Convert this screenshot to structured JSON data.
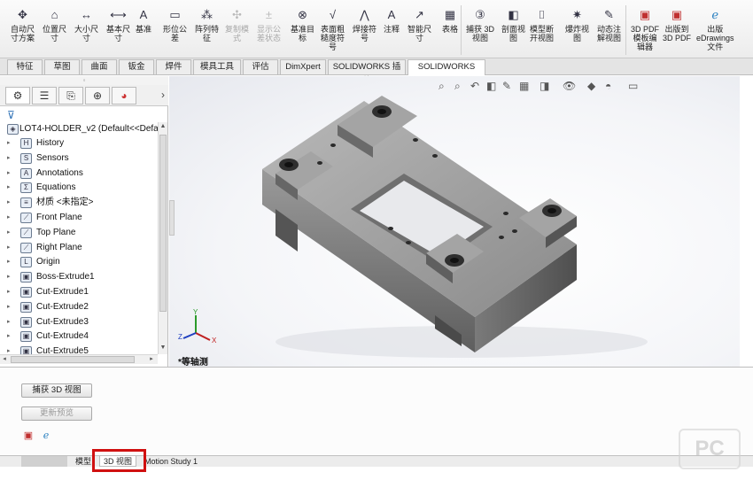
{
  "ribbon": {
    "buttons": [
      {
        "label": "自动尺\n寸方案",
        "icon": "smart-dim-scheme-icon",
        "enabled": true
      },
      {
        "label": "位置尺\n寸",
        "icon": "location-dim-icon",
        "enabled": true
      },
      {
        "label": "大小尺\n寸",
        "icon": "size-dim-icon",
        "enabled": true
      },
      {
        "label": "基本尺\n寸",
        "icon": "basic-dim-icon",
        "enabled": true
      },
      {
        "label": "基准",
        "icon": "datum-icon",
        "enabled": true
      },
      {
        "label": "形位公\n差",
        "icon": "geometric-tolerance-icon",
        "enabled": true
      },
      {
        "label": "阵列特\n征",
        "icon": "pattern-feature-icon",
        "enabled": true
      },
      {
        "label": "复制模\n式",
        "icon": "copy-scheme-icon",
        "enabled": false
      },
      {
        "label": "显示公\n差状态",
        "icon": "tolerance-status-icon",
        "enabled": false
      },
      {
        "label": "基准目\n标",
        "icon": "datum-target-icon",
        "enabled": true
      },
      {
        "label": "表面粗\n糙度符\n号",
        "icon": "surface-finish-icon",
        "enabled": true
      },
      {
        "label": "焊接符\n号",
        "icon": "weld-symbol-icon",
        "enabled": true
      },
      {
        "label": "注释",
        "icon": "note-icon",
        "enabled": true
      },
      {
        "label": "智能尺\n寸",
        "icon": "smart-dimension-icon",
        "enabled": true
      },
      {
        "label": "表格",
        "icon": "table-icon",
        "enabled": true
      },
      {
        "label": "捕获 3D\n视图",
        "icon": "capture-3d-view-icon",
        "enabled": true
      },
      {
        "label": "剖面视\n图",
        "icon": "section-view-icon",
        "enabled": true
      },
      {
        "label": "模型断\n开视图",
        "icon": "model-break-view-icon",
        "enabled": true
      },
      {
        "label": "爆炸视\n图",
        "icon": "exploded-view-icon",
        "enabled": true
      },
      {
        "label": "动态注\n解视图",
        "icon": "dynamic-annotation-view-icon",
        "enabled": true
      },
      {
        "label": "3D PDF\n模板编\n辑器",
        "icon": "3d-pdf-template-icon",
        "enabled": true
      },
      {
        "label": "出版到\n3D PDF",
        "icon": "publish-3d-pdf-icon",
        "enabled": true
      },
      {
        "label": "出版\neDrawings\n文件",
        "icon": "edrawings-icon",
        "enabled": true
      }
    ]
  },
  "tabs": [
    "特征",
    "草图",
    "曲面",
    "钣金",
    "焊件",
    "模具工具",
    "评估",
    "DimXpert",
    "SOLIDWORKS 插件",
    "SOLIDWORKS MBD"
  ],
  "active_tab": "SOLIDWORKS MBD",
  "tree": {
    "root": "LOT4-HOLDER_v2  (Default<<Defa",
    "items": [
      {
        "label": "History",
        "icon": "history-icon",
        "glyph": "H"
      },
      {
        "label": "Sensors",
        "icon": "sensors-icon",
        "glyph": "S"
      },
      {
        "label": "Annotations",
        "icon": "annotations-icon",
        "glyph": "A"
      },
      {
        "label": "Equations",
        "icon": "equations-icon",
        "glyph": "Σ"
      },
      {
        "label": "材质 <未指定>",
        "icon": "material-icon",
        "glyph": "≡"
      },
      {
        "label": "Front Plane",
        "icon": "plane-icon",
        "glyph": "⟋"
      },
      {
        "label": "Top Plane",
        "icon": "plane-icon",
        "glyph": "⟋"
      },
      {
        "label": "Right Plane",
        "icon": "plane-icon",
        "glyph": "⟋"
      },
      {
        "label": "Origin",
        "icon": "origin-icon",
        "glyph": "L"
      },
      {
        "label": "Boss-Extrude1",
        "icon": "extrude-icon",
        "glyph": "▣"
      },
      {
        "label": "Cut-Extrude1",
        "icon": "cut-extrude-icon",
        "glyph": "▣"
      },
      {
        "label": "Cut-Extrude2",
        "icon": "cut-extrude-icon",
        "glyph": "▣"
      },
      {
        "label": "Cut-Extrude3",
        "icon": "cut-extrude-icon",
        "glyph": "▣"
      },
      {
        "label": "Cut-Extrude4",
        "icon": "cut-extrude-icon",
        "glyph": "▣"
      },
      {
        "label": "Cut-Extrude5",
        "icon": "cut-extrude-icon",
        "glyph": "▣"
      }
    ]
  },
  "viewport": {
    "view_label": "*等轴测",
    "triad": {
      "x": "X",
      "y": "Y",
      "z": "Z"
    }
  },
  "bottom": {
    "capture_button": "捕获 3D 视图",
    "update_button": "更新预览"
  },
  "bottom_tabs": {
    "tab1": "模型",
    "tab2": "3D 视图",
    "tab3": "Motion Study 1"
  },
  "colors": {
    "highlight": "#d01010",
    "part": "#8c8c8c"
  }
}
